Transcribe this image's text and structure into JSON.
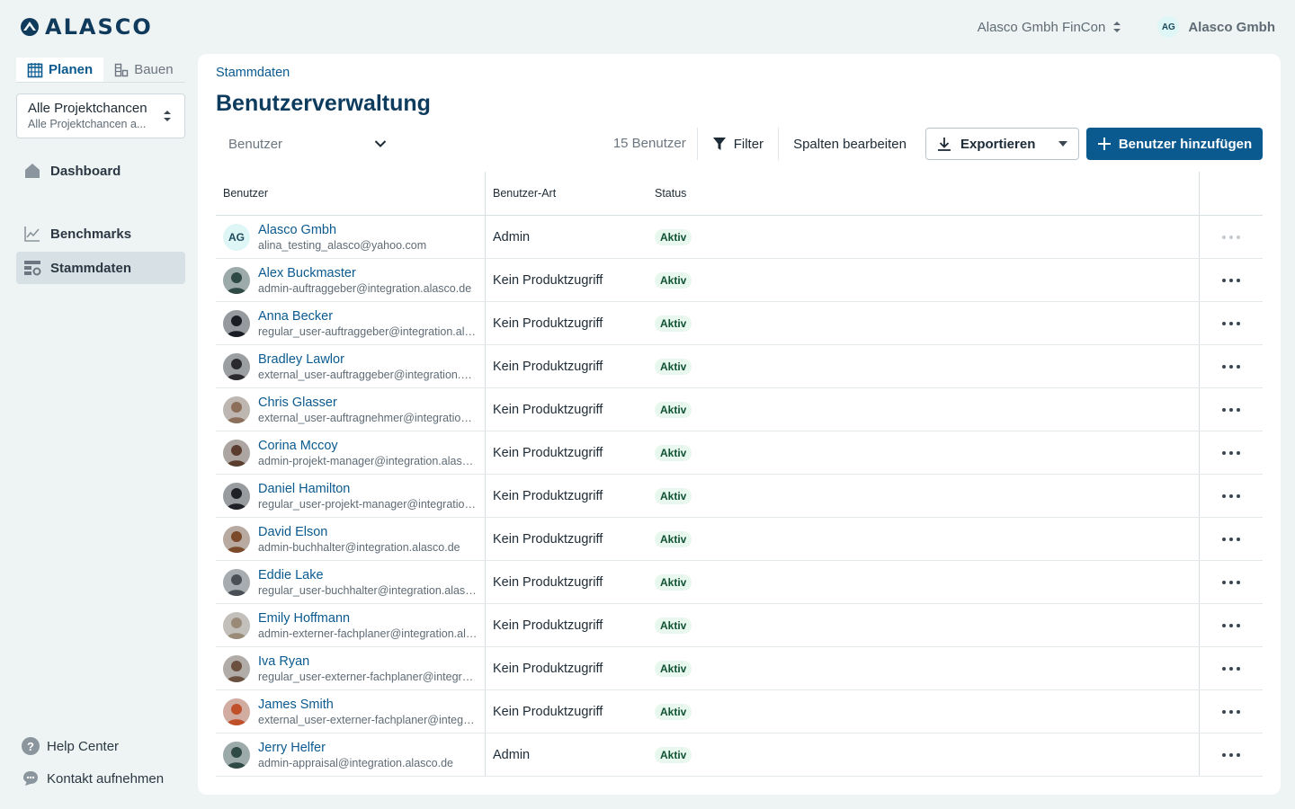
{
  "brand": {
    "logo_text": "ALASCO"
  },
  "header": {
    "org_switcher": "Alasco Gmbh FinCon",
    "user_initials": "AG",
    "user_name": "Alasco Gmbh"
  },
  "sidebar": {
    "mode_tabs": [
      {
        "label": "Planen",
        "icon": "calendar-icon",
        "active": true
      },
      {
        "label": "Bauen",
        "icon": "crane-icon",
        "active": false
      }
    ],
    "project_select": {
      "title": "Alle Projektchancen",
      "subtitle": "Alle Projektchancen a..."
    },
    "nav": [
      {
        "label": "Dashboard",
        "icon": "home-icon"
      },
      {
        "label": "Benchmarks",
        "icon": "chart-line-icon"
      },
      {
        "label": "Stammdaten",
        "icon": "master-data-icon",
        "active": true
      }
    ],
    "bottom": [
      {
        "label": "Help Center",
        "icon": "help-icon"
      },
      {
        "label": "Kontakt aufnehmen",
        "icon": "chat-icon"
      }
    ]
  },
  "main": {
    "breadcrumb": "Stammdaten",
    "title": "Benutzerverwaltung",
    "toolbar": {
      "user_filter_placeholder": "Benutzer",
      "count": "15 Benutzer",
      "filter_label": "Filter",
      "edit_columns_label": "Spalten bearbeiten",
      "export_label": "Exportieren",
      "add_user_label": "Benutzer hinzufügen"
    },
    "table": {
      "columns": [
        "Benutzer",
        "Benutzer-Art",
        "Status"
      ],
      "rows": [
        {
          "name": "Alasco Gmbh",
          "email": "alina_testing_alasco@yahoo.com",
          "type": "Admin",
          "status": "Aktiv",
          "initials": "AG"
        },
        {
          "name": "Alex Buckmaster",
          "email": "admin-auftraggeber@integration.alasco.de",
          "type": "Kein Produktzugriff",
          "status": "Aktiv"
        },
        {
          "name": "Anna Becker",
          "email": "regular_user-auftraggeber@integration.alasco.de",
          "type": "Kein Produktzugriff",
          "status": "Aktiv"
        },
        {
          "name": "Bradley Lawlor",
          "email": "external_user-auftraggeber@integration.alasco.de",
          "type": "Kein Produktzugriff",
          "status": "Aktiv"
        },
        {
          "name": "Chris Glasser",
          "email": "external_user-auftragnehmer@integration.alasco.de",
          "type": "Kein Produktzugriff",
          "status": "Aktiv"
        },
        {
          "name": "Corina Mccoy",
          "email": "admin-projekt-manager@integration.alasco.de",
          "type": "Kein Produktzugriff",
          "status": "Aktiv"
        },
        {
          "name": "Daniel Hamilton",
          "email": "regular_user-projekt-manager@integration.alasco.de",
          "type": "Kein Produktzugriff",
          "status": "Aktiv"
        },
        {
          "name": "David Elson",
          "email": "admin-buchhalter@integration.alasco.de",
          "type": "Kein Produktzugriff",
          "status": "Aktiv"
        },
        {
          "name": "Eddie Lake",
          "email": "regular_user-buchhalter@integration.alasco.de",
          "type": "Kein Produktzugriff",
          "status": "Aktiv"
        },
        {
          "name": "Emily Hoffmann",
          "email": "admin-externer-fachplaner@integration.alasco.de",
          "type": "Kein Produktzugriff",
          "status": "Aktiv"
        },
        {
          "name": "Iva Ryan",
          "email": "regular_user-externer-fachplaner@integration.alasco.de",
          "type": "Kein Produktzugriff",
          "status": "Aktiv"
        },
        {
          "name": "James Smith",
          "email": "external_user-externer-fachplaner@integration.alasco.de",
          "type": "Kein Produktzugriff",
          "status": "Aktiv"
        },
        {
          "name": "Jerry Helfer",
          "email": "admin-appraisal@integration.alasco.de",
          "type": "Admin",
          "status": "Aktiv"
        }
      ]
    }
  },
  "colors": {
    "brand": "#0b5a8f",
    "background": "#eef3f3",
    "active_badge": "#e8f8ee"
  }
}
